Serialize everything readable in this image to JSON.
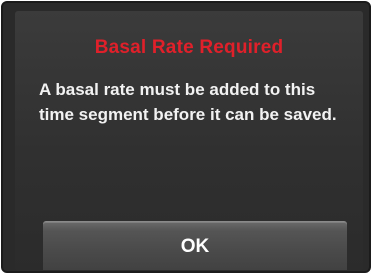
{
  "dialog": {
    "title": "Basal Rate Required",
    "message": "A basal rate must be added to this time segment before it can be saved.",
    "title_color": "#e0202a"
  },
  "buttons": {
    "ok_label": "OK"
  }
}
